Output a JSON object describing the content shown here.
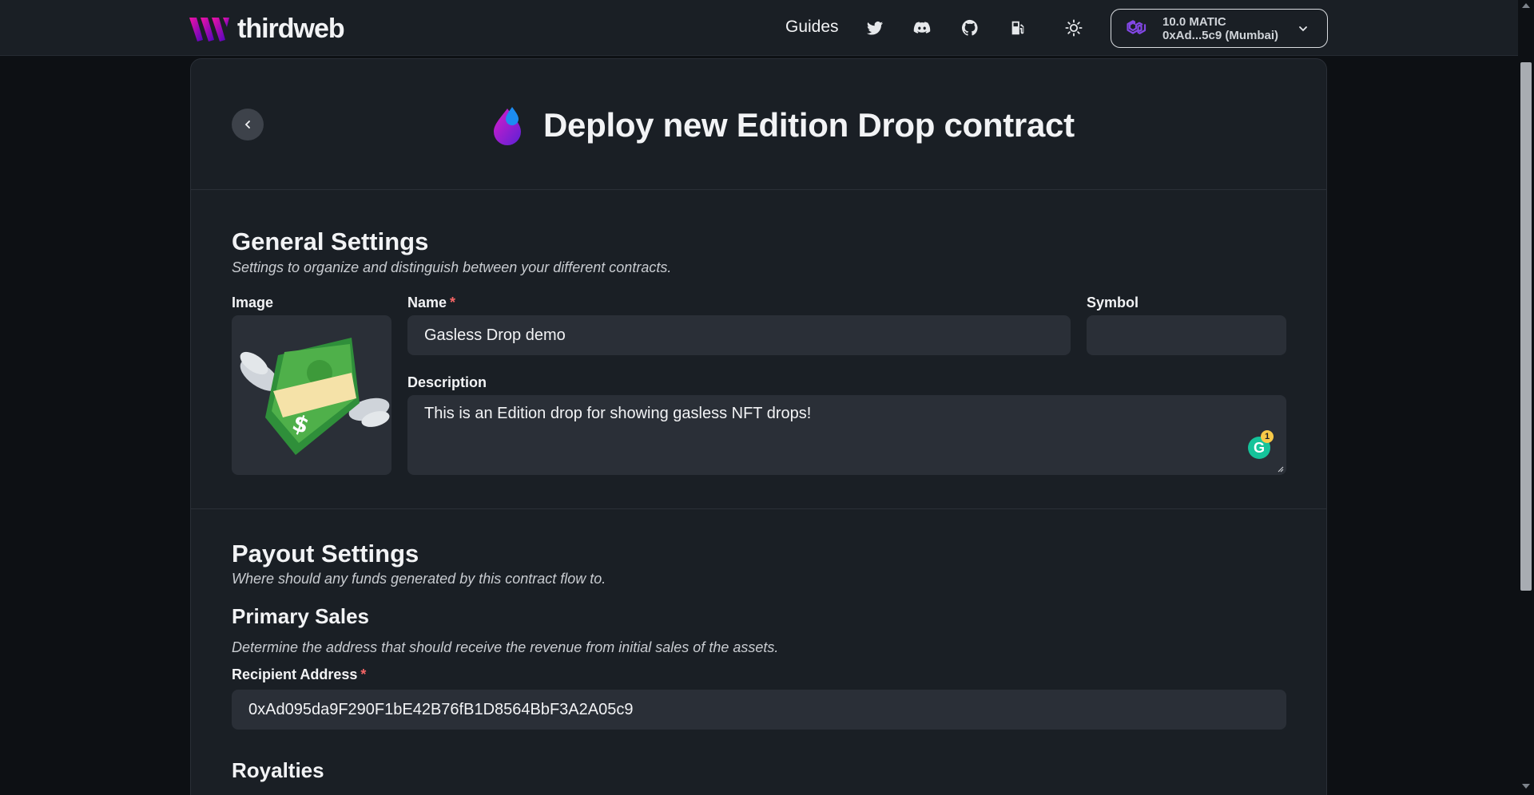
{
  "brand": {
    "name": "thirdweb"
  },
  "nav": {
    "guides_label": "Guides",
    "icons": [
      "twitter-icon",
      "discord-icon",
      "github-icon",
      "gas-station-icon",
      "sun-icon"
    ]
  },
  "wallet": {
    "balance": "10.0 MATIC",
    "address": "0xAd...5c9 (Mumbai)"
  },
  "header": {
    "title": "Deploy new Edition Drop contract"
  },
  "general": {
    "title": "General Settings",
    "subtitle": "Settings to organize and distinguish between your different contracts.",
    "image_label": "Image",
    "name_label": "Name",
    "name_value": "Gasless Drop demo",
    "symbol_label": "Symbol",
    "symbol_value": "",
    "description_label": "Description",
    "description_value": "This is an Edition drop for showing gasless NFT drops!",
    "grammarly_count": "1"
  },
  "payout": {
    "title": "Payout Settings",
    "subtitle": "Where should any funds generated by this contract flow to.",
    "primary_title": "Primary Sales",
    "primary_subtitle": "Determine the address that should receive the revenue from initial sales of the assets.",
    "recipient_label": "Recipient Address",
    "recipient_value": "0xAd095da9F290F1bE42B76fB1D8564BbF3A2A05c9",
    "required_mark": "*"
  },
  "royalties": {
    "title": "Royalties"
  },
  "colors": {
    "background": "#0d1014",
    "card": "#1a1f25",
    "input": "#2a2f37",
    "required": "#f56565",
    "brand_gradient_start": "#f213a4",
    "brand_gradient_end": "#5204bf"
  }
}
